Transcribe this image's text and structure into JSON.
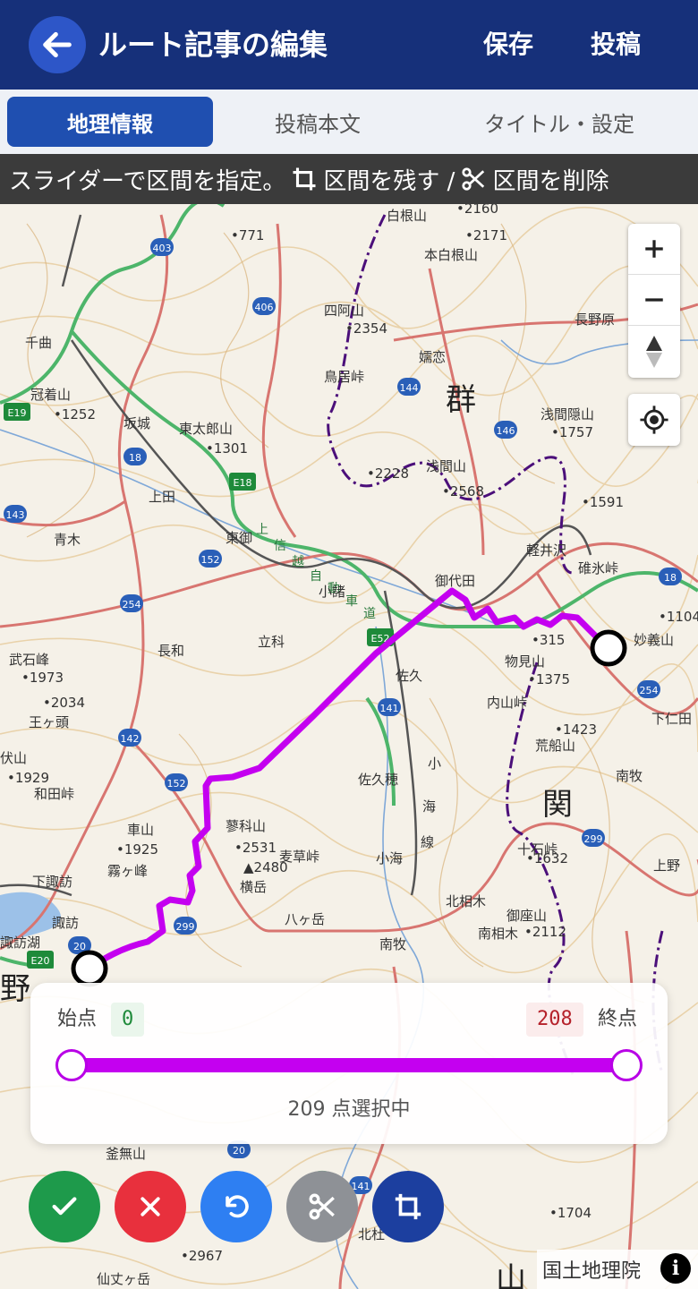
{
  "header": {
    "title": "ルート記事の編集",
    "save_label": "保存",
    "post_label": "投稿"
  },
  "tabs": [
    {
      "label": "地理情報",
      "active": true
    },
    {
      "label": "投稿本文",
      "active": false
    },
    {
      "label": "タイトル・設定",
      "active": false
    }
  ],
  "banner": {
    "text_1": "スライダーで区間を指定。",
    "text_2": "区間を残す /",
    "text_3": "区間を削除"
  },
  "map": {
    "labels": [
      "白根山",
      "本白根山",
      "四阿山",
      "•2354",
      "嬬恋",
      "鳥居峠",
      "群",
      "冠着山",
      "•1252",
      "坂城",
      "東太郎山",
      "•1301",
      "浅間隠山",
      "•1757",
      "•2228",
      "浅間山",
      "•2568",
      "上田",
      "青木",
      "東御",
      "上",
      "信",
      "越",
      "自",
      "動",
      "車",
      "道",
      "小諸",
      "御代田",
      "軽井沢",
      "碓氷峠",
      "妙義山",
      "長和",
      "立科",
      "佐久",
      "物見山",
      "•1375",
      "内山峠",
      "武石峰",
      "•1973",
      "•2034",
      "王ヶ頭",
      "•1423",
      "荒船山",
      "南牧",
      "関",
      "伏山",
      "•1929",
      "和田峠",
      "佐久穂",
      "小",
      "海",
      "線",
      "車山",
      "•1925",
      "霧ヶ峰",
      "蓼科山",
      "•2531",
      "麦草峠",
      "▲2480",
      "横岳",
      "小海",
      "十石峠",
      "•1632",
      "上野",
      "下諏訪",
      "諏訪",
      "北相木",
      "御座山",
      "南相木",
      "•2112",
      "八ヶ岳",
      "南牧",
      "諏訪湖",
      "野",
      "下仁田",
      "•1104",
      "長野原",
      "千曲",
      "釜無山",
      "•1704",
      "北杜",
      "•2967",
      "仙丈ヶ岳",
      "山",
      "•2171",
      "•2160",
      "•771",
      "•1591",
      "•315"
    ],
    "road_numbers": [
      "403",
      "406",
      "144",
      "146",
      "18",
      "E18",
      "E19",
      "143",
      "152",
      "254",
      "142",
      "152",
      "299",
      "299",
      "20",
      "E20",
      "E52",
      "141",
      "18",
      "254",
      "20",
      "141"
    ]
  },
  "map_controls": {
    "zoom_in": "plus-icon",
    "zoom_out": "minus-icon",
    "compass": "compass-icon",
    "locate": "locate-icon"
  },
  "slider": {
    "start_label": "始点",
    "end_label": "終点",
    "start_value": "0",
    "end_value": "208",
    "selection_text": "209 点選択中"
  },
  "actions": {
    "confirm": "check-icon",
    "cancel": "close-icon",
    "undo": "undo-icon",
    "cut": "scissors-icon",
    "crop": "crop-icon"
  },
  "attribution": {
    "text": "国土地理院",
    "info_glyph": "i"
  },
  "colors": {
    "header": "#16307a",
    "route": "#c400f0",
    "tab_active": "#1f4fb0"
  }
}
